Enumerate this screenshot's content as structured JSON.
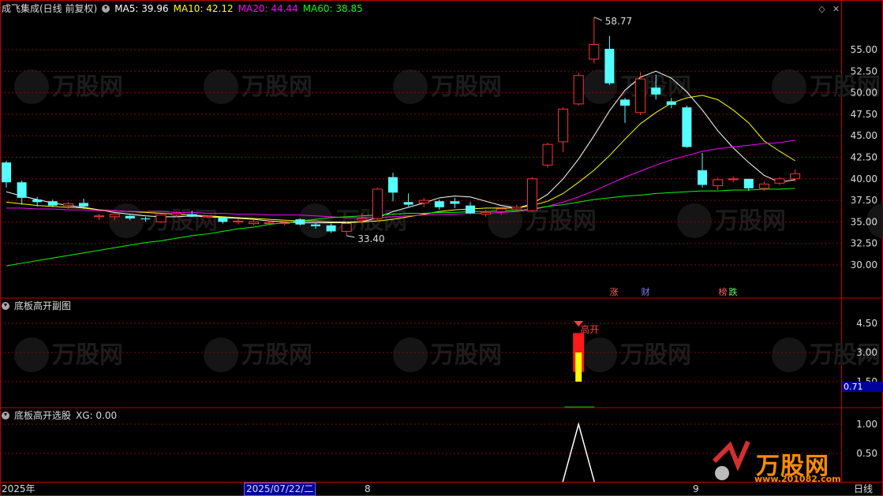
{
  "main_panel": {
    "stock_title": "成飞集成(日线 前复权)",
    "ma5": "MA5: 39.96",
    "ma10": "MA10: 42.12",
    "ma20": "MA20: 44.44",
    "ma60": "MA60: 38.85",
    "high_label": "58.77",
    "low_label": "33.40",
    "price_ticks": [
      "55.00",
      "52.50",
      "50.00",
      "47.50",
      "45.00",
      "42.50",
      "40.00",
      "37.50",
      "35.00",
      "32.50",
      "30.00"
    ],
    "event_badges": [
      {
        "text": "涨",
        "color": "#ff6060"
      },
      {
        "text": "财",
        "color": "#8080ff"
      },
      {
        "text": "榜",
        "color": "#ff6060"
      },
      {
        "text": "跌",
        "color": "#60ff60"
      }
    ]
  },
  "sub_panel_1": {
    "title": "底板高开副图",
    "signal_label": "高开",
    "ticks": [
      "4.50",
      "3.00",
      "1.50"
    ],
    "current_value": "0.71"
  },
  "sub_panel_2": {
    "title": "底板高开选股",
    "xg": "XG: 0.00",
    "ticks": [
      "1.00",
      "0.50"
    ]
  },
  "timeline": {
    "year": "2025年",
    "cursor_date": "2025/07/22/二",
    "month_8": "8",
    "month_9": "9",
    "period": "日线"
  },
  "watermark": {
    "text": "万股网",
    "url": "www.201082.com"
  },
  "colors": {
    "up": "#ff3232",
    "down": "#54ffff",
    "ma5": "#ffffff",
    "ma10": "#ffff00",
    "ma20": "#ff00ff",
    "ma60": "#00ff00",
    "grid": "#8b0000"
  },
  "chart_data": {
    "type": "candlestick",
    "price_axis": [
      30,
      55
    ],
    "candles": [
      {
        "o": 41.9,
        "h": 42.1,
        "l": 39.0,
        "c": 39.6
      },
      {
        "o": 39.6,
        "h": 39.8,
        "l": 37.0,
        "c": 37.8
      },
      {
        "o": 37.6,
        "h": 37.9,
        "l": 36.8,
        "c": 37.3
      },
      {
        "o": 37.4,
        "h": 37.6,
        "l": 36.7,
        "c": 36.9
      },
      {
        "o": 36.9,
        "h": 37.3,
        "l": 36.5,
        "c": 37.1
      },
      {
        "o": 37.2,
        "h": 37.7,
        "l": 36.5,
        "c": 36.8
      },
      {
        "o": 35.6,
        "h": 35.9,
        "l": 35.2,
        "c": 35.7
      },
      {
        "o": 35.6,
        "h": 36.0,
        "l": 35.2,
        "c": 35.9
      },
      {
        "o": 35.7,
        "h": 35.8,
        "l": 35.2,
        "c": 35.4
      },
      {
        "o": 35.4,
        "h": 35.6,
        "l": 35.0,
        "c": 35.3
      },
      {
        "o": 35.0,
        "h": 35.9,
        "l": 34.9,
        "c": 35.8
      },
      {
        "o": 35.8,
        "h": 36.2,
        "l": 35.5,
        "c": 36.0
      },
      {
        "o": 35.9,
        "h": 36.3,
        "l": 35.6,
        "c": 35.6
      },
      {
        "o": 35.6,
        "h": 35.8,
        "l": 35.5,
        "c": 35.7
      },
      {
        "o": 35.5,
        "h": 35.6,
        "l": 34.8,
        "c": 35.0
      },
      {
        "o": 35.0,
        "h": 35.3,
        "l": 34.7,
        "c": 35.1
      },
      {
        "o": 34.8,
        "h": 35.2,
        "l": 34.6,
        "c": 35.0
      },
      {
        "o": 34.8,
        "h": 35.2,
        "l": 34.6,
        "c": 34.9
      },
      {
        "o": 34.8,
        "h": 35.1,
        "l": 34.6,
        "c": 34.9
      },
      {
        "o": 35.3,
        "h": 35.4,
        "l": 34.6,
        "c": 34.7
      },
      {
        "o": 34.7,
        "h": 34.9,
        "l": 34.2,
        "c": 34.5
      },
      {
        "o": 34.6,
        "h": 34.8,
        "l": 33.7,
        "c": 33.9
      },
      {
        "o": 33.9,
        "h": 35.0,
        "l": 33.4,
        "c": 34.8
      },
      {
        "o": 35.2,
        "h": 36.0,
        "l": 34.7,
        "c": 35.4
      },
      {
        "o": 35.4,
        "h": 39.0,
        "l": 35.0,
        "c": 38.8
      },
      {
        "o": 40.2,
        "h": 40.7,
        "l": 37.4,
        "c": 38.4
      },
      {
        "o": 37.3,
        "h": 38.3,
        "l": 36.8,
        "c": 37.0
      },
      {
        "o": 37.2,
        "h": 37.8,
        "l": 36.7,
        "c": 37.5
      },
      {
        "o": 37.4,
        "h": 37.6,
        "l": 36.4,
        "c": 36.7
      },
      {
        "o": 37.4,
        "h": 37.8,
        "l": 36.6,
        "c": 37.1
      },
      {
        "o": 36.9,
        "h": 37.3,
        "l": 35.9,
        "c": 36.0
      },
      {
        "o": 35.9,
        "h": 36.4,
        "l": 35.6,
        "c": 36.1
      },
      {
        "o": 36.2,
        "h": 36.6,
        "l": 35.8,
        "c": 36.5
      },
      {
        "o": 36.5,
        "h": 37.0,
        "l": 36.2,
        "c": 36.7
      },
      {
        "o": 36.3,
        "h": 40.2,
        "l": 36.2,
        "c": 40.0
      },
      {
        "o": 41.6,
        "h": 44.2,
        "l": 41.3,
        "c": 44.0
      },
      {
        "o": 44.3,
        "h": 48.3,
        "l": 43.1,
        "c": 48.1
      },
      {
        "o": 48.7,
        "h": 52.3,
        "l": 48.5,
        "c": 52.0
      },
      {
        "o": 53.9,
        "h": 58.77,
        "l": 53.4,
        "c": 55.6
      },
      {
        "o": 55.1,
        "h": 56.6,
        "l": 50.9,
        "c": 51.1
      },
      {
        "o": 49.2,
        "h": 49.4,
        "l": 46.5,
        "c": 48.5
      },
      {
        "o": 47.7,
        "h": 52.4,
        "l": 47.4,
        "c": 51.6
      },
      {
        "o": 50.6,
        "h": 52.1,
        "l": 49.2,
        "c": 49.8
      },
      {
        "o": 49.0,
        "h": 49.4,
        "l": 48.2,
        "c": 48.6
      },
      {
        "o": 48.3,
        "h": 48.5,
        "l": 43.6,
        "c": 43.7
      },
      {
        "o": 41.0,
        "h": 43.0,
        "l": 39.0,
        "c": 39.3
      },
      {
        "o": 39.2,
        "h": 40.1,
        "l": 38.7,
        "c": 39.9
      },
      {
        "o": 39.9,
        "h": 40.3,
        "l": 39.6,
        "c": 40.0
      },
      {
        "o": 40.0,
        "h": 40.0,
        "l": 38.6,
        "c": 38.9
      },
      {
        "o": 38.9,
        "h": 39.7,
        "l": 38.6,
        "c": 39.4
      },
      {
        "o": 39.5,
        "h": 40.2,
        "l": 39.3,
        "c": 40.0
      },
      {
        "o": 40.0,
        "h": 41.1,
        "l": 39.7,
        "c": 40.6
      }
    ],
    "series": [
      {
        "name": "MA5",
        "values": [
          38.5,
          38.0,
          37.6,
          37.2,
          36.9,
          36.7,
          36.4,
          36.1,
          35.9,
          35.7,
          35.6,
          35.6,
          35.7,
          35.6,
          35.5,
          35.4,
          35.3,
          35.1,
          35.0,
          34.9,
          34.9,
          34.9,
          34.9,
          35.0,
          35.5,
          36.2,
          36.7,
          37.2,
          37.8,
          38.0,
          37.9,
          37.4,
          36.9,
          36.6,
          37.1,
          38.2,
          40.0,
          42.3,
          45.0,
          47.9,
          50.3,
          51.8,
          52.5,
          51.7,
          50.1,
          48.0,
          45.6,
          43.6,
          41.9,
          40.4,
          39.6,
          39.9
        ]
      },
      {
        "name": "MA10",
        "values": [
          37.3,
          37.1,
          36.9,
          36.8,
          36.7,
          36.6,
          36.4,
          36.3,
          36.2,
          36.1,
          36.0,
          35.9,
          35.8,
          35.7,
          35.6,
          35.5,
          35.4,
          35.3,
          35.2,
          35.1,
          35.1,
          35.0,
          35.0,
          35.0,
          35.1,
          35.3,
          35.6,
          35.9,
          36.2,
          36.4,
          36.5,
          36.6,
          36.6,
          36.6,
          36.9,
          37.4,
          38.3,
          39.6,
          41.0,
          42.7,
          44.6,
          46.4,
          47.7,
          48.8,
          49.4,
          49.7,
          49.2,
          48.0,
          46.5,
          44.4,
          43.2,
          42.1
        ]
      },
      {
        "name": "MA20",
        "values": [
          36.6,
          36.6,
          36.5,
          36.5,
          36.4,
          36.4,
          36.3,
          36.3,
          36.2,
          36.2,
          36.2,
          36.1,
          36.1,
          36.0,
          36.0,
          35.9,
          35.9,
          35.8,
          35.8,
          35.8,
          35.7,
          35.6,
          35.5,
          35.5,
          35.5,
          35.6,
          35.7,
          35.8,
          35.9,
          35.9,
          36.0,
          36.0,
          36.1,
          36.2,
          36.4,
          36.8,
          37.3,
          37.9,
          38.6,
          39.4,
          40.2,
          40.9,
          41.6,
          42.2,
          42.7,
          43.2,
          43.5,
          43.7,
          43.9,
          44.1,
          44.2,
          44.5
        ]
      },
      {
        "name": "MA60",
        "values": [
          29.9,
          30.2,
          30.5,
          30.8,
          31.1,
          31.4,
          31.7,
          32.0,
          32.3,
          32.6,
          32.8,
          33.1,
          33.4,
          33.6,
          33.9,
          34.2,
          34.4,
          34.7,
          34.9,
          35.1,
          35.3,
          35.5,
          35.6,
          35.7,
          35.8,
          35.9,
          36.0,
          36.0,
          36.1,
          36.1,
          36.2,
          36.2,
          36.3,
          36.3,
          36.5,
          36.8,
          37.0,
          37.3,
          37.6,
          37.8,
          38.0,
          38.1,
          38.3,
          38.4,
          38.5,
          38.6,
          38.6,
          38.7,
          38.7,
          38.8,
          38.8,
          38.9
        ]
      }
    ],
    "sub1_signal": {
      "index": 37,
      "red": [
        2.0,
        4.0
      ],
      "yellow": [
        1.5,
        3.0
      ]
    },
    "sub2_signal": {
      "index": 37,
      "value": 1.0
    }
  }
}
